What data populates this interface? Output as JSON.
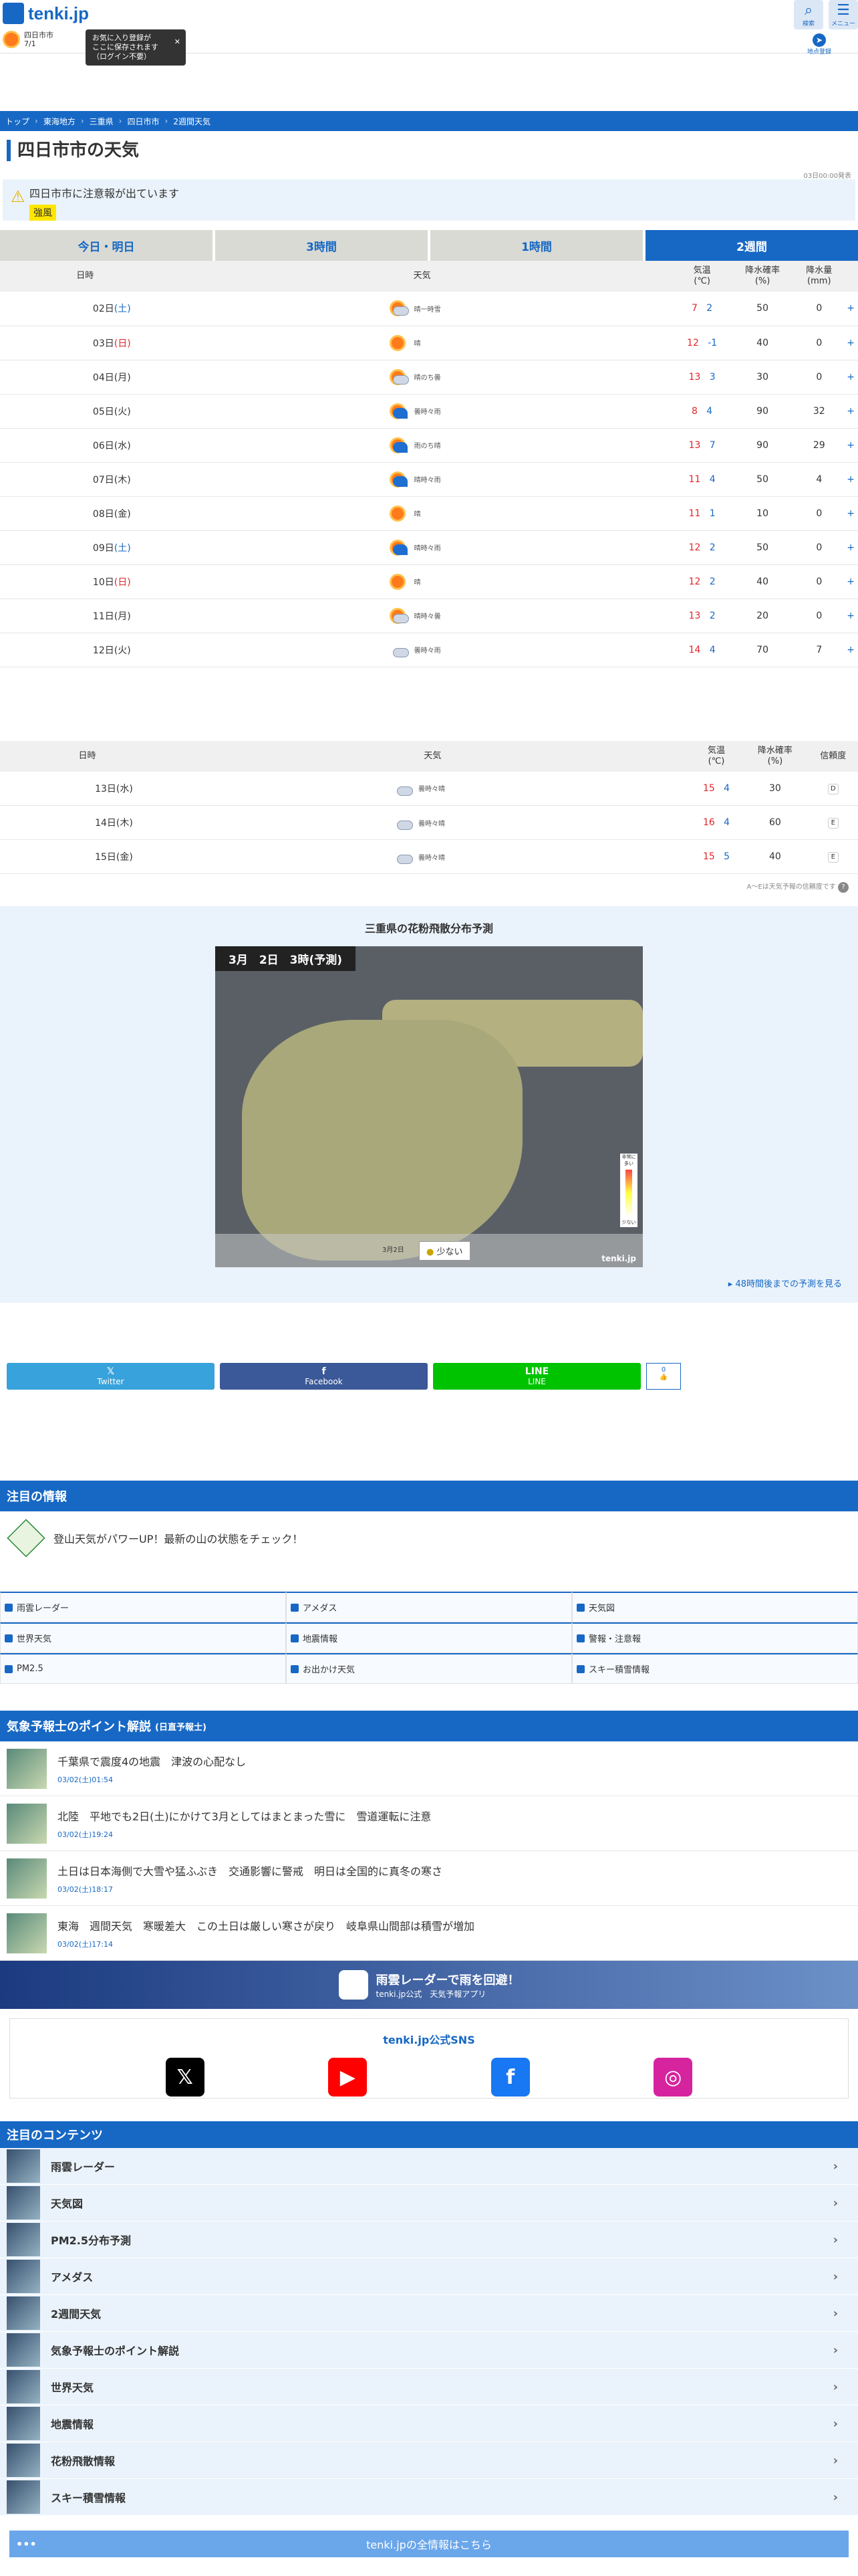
{
  "header": {
    "logo": "tenki.jp",
    "location_name": "四日市市",
    "location_temp": "7/1",
    "tooltip": "お気に入り登録が\nここに保存されます\n（ログイン不要）",
    "search_label": "検索",
    "menu_label": "メニュー",
    "register_label": "地点登録"
  },
  "breadcrumb": [
    "トップ",
    "東海地方",
    "三重県",
    "四日市市",
    "2週間天気"
  ],
  "page_title": "四日市市の天気",
  "updated": "03日00:00発表",
  "warning": {
    "text": "四日市市に注意報が出ています",
    "badge": "強風"
  },
  "tabs": [
    "今日・明日",
    "3時間",
    "1時間",
    "2週間"
  ],
  "table1": {
    "headers": [
      "日時",
      "天気",
      "気温\n(℃)",
      "降水確率\n(%)",
      "降水量\n(mm)",
      ""
    ],
    "rows": [
      {
        "date": "02日",
        "dow": "(土)",
        "cls": "sat",
        "wx": "晴一時雪",
        "icon": "sun-cloud",
        "hi": "7",
        "lo": "2",
        "pop": "50",
        "rain": "0"
      },
      {
        "date": "03日",
        "dow": "(日)",
        "cls": "sun",
        "wx": "晴",
        "icon": "sun",
        "hi": "12",
        "lo": "-1",
        "pop": "40",
        "rain": "0"
      },
      {
        "date": "04日",
        "dow": "(月)",
        "cls": "",
        "wx": "晴のち曇",
        "icon": "sun-cloud",
        "hi": "13",
        "lo": "3",
        "pop": "30",
        "rain": "0"
      },
      {
        "date": "05日",
        "dow": "(火)",
        "cls": "",
        "wx": "曇時々雨",
        "icon": "rain",
        "hi": "8",
        "lo": "4",
        "pop": "90",
        "rain": "32"
      },
      {
        "date": "06日",
        "dow": "(水)",
        "cls": "",
        "wx": "雨のち晴",
        "icon": "rain",
        "hi": "13",
        "lo": "7",
        "pop": "90",
        "rain": "29"
      },
      {
        "date": "07日",
        "dow": "(木)",
        "cls": "",
        "wx": "晴時々雨",
        "icon": "rain",
        "hi": "11",
        "lo": "4",
        "pop": "50",
        "rain": "4"
      },
      {
        "date": "08日",
        "dow": "(金)",
        "cls": "",
        "wx": "晴",
        "icon": "sun",
        "hi": "11",
        "lo": "1",
        "pop": "10",
        "rain": "0"
      },
      {
        "date": "09日",
        "dow": "(土)",
        "cls": "sat",
        "wx": "晴時々雨",
        "icon": "rain",
        "hi": "12",
        "lo": "2",
        "pop": "50",
        "rain": "0"
      },
      {
        "date": "10日",
        "dow": "(日)",
        "cls": "sun",
        "wx": "晴",
        "icon": "sun",
        "hi": "12",
        "lo": "2",
        "pop": "40",
        "rain": "0"
      },
      {
        "date": "11日",
        "dow": "(月)",
        "cls": "",
        "wx": "晴時々曇",
        "icon": "sun-cloud",
        "hi": "13",
        "lo": "2",
        "pop": "20",
        "rain": "0"
      },
      {
        "date": "12日",
        "dow": "(火)",
        "cls": "",
        "wx": "曇時々雨",
        "icon": "cloud",
        "hi": "14",
        "lo": "4",
        "pop": "70",
        "rain": "7"
      }
    ]
  },
  "table2": {
    "headers": [
      "日時",
      "天気",
      "気温\n(℃)",
      "降水確率\n(%)",
      "信頼度"
    ],
    "rows": [
      {
        "date": "13日",
        "dow": "(水)",
        "cls": "",
        "wx": "曇時々晴",
        "icon": "cloud",
        "hi": "15",
        "lo": "4",
        "pop": "30",
        "rel": "D"
      },
      {
        "date": "14日",
        "dow": "(木)",
        "cls": "",
        "wx": "曇時々晴",
        "icon": "cloud",
        "hi": "16",
        "lo": "4",
        "pop": "60",
        "rel": "E"
      },
      {
        "date": "15日",
        "dow": "(金)",
        "cls": "",
        "wx": "曇時々晴",
        "icon": "cloud",
        "hi": "15",
        "lo": "5",
        "pop": "40",
        "rel": "E"
      }
    ],
    "note": "A〜Eは天気予報の信頼度です"
  },
  "pollen": {
    "title": "三重県の花粉飛散分布予測",
    "map_header": "3月　2日　3時(予測)",
    "date_label": "3月2日",
    "level": "少ない",
    "legend_hi": "非常に多い",
    "legend_lo": "少ない",
    "watermark": "tenki.jp",
    "more": "48時間後までの予測を見る"
  },
  "share": [
    {
      "label": "Twitter",
      "glyph": "𝕏",
      "color": "#37a2db"
    },
    {
      "label": "Facebook",
      "glyph": "f",
      "color": "#3b5998"
    },
    {
      "label": "LINE",
      "glyph": "LINE",
      "color": "#00c300"
    }
  ],
  "like_count": "0",
  "attention": {
    "title": "注目の情報",
    "text": "登山天気がパワーUP！最新の山の状態をチェック！"
  },
  "links": [
    "雨雲レーダー",
    "アメダス",
    "天気図",
    "世界天気",
    "地震情報",
    "警報・注意報",
    "PM2.5",
    "お出かけ天気",
    "スキー積雪情報"
  ],
  "points": {
    "title": "気象予報士のポイント解説",
    "sub": "(日直予報士)",
    "items": [
      {
        "title": "千葉県で震度4の地震　津波の心配なし",
        "date": "03/02(土)01:54"
      },
      {
        "title": "北陸　平地でも2日(土)にかけて3月としてはまとまった雪に　雪道運転に注意",
        "date": "03/02(土)19:24"
      },
      {
        "title": "土日は日本海側で大雪や猛ふぶき　交通影響に警戒　明日は全国的に真冬の寒さ",
        "date": "03/02(土)18:17"
      },
      {
        "title": "東海　週間天気　寒暖差大　この土日は厳しい寒さが戻り　岐阜県山間部は積雪が増加",
        "date": "03/02(土)17:14"
      }
    ]
  },
  "banner": {
    "title": "雨雲レーダーで雨を回避！",
    "sub": "tenki.jp公式　天気予報アプリ"
  },
  "sns": {
    "title": "tenki.jp公式SNS",
    "items": [
      {
        "name": "x-icon",
        "glyph": "𝕏",
        "color": "#000"
      },
      {
        "name": "youtube-icon",
        "glyph": "▶",
        "color": "#f00"
      },
      {
        "name": "facebook-icon",
        "glyph": "f",
        "color": "#1877f2"
      },
      {
        "name": "instagram-icon",
        "glyph": "◎",
        "color": "#d6249f"
      }
    ]
  },
  "contents": {
    "title": "注目のコンテンツ",
    "items": [
      "雨雲レーダー",
      "天気図",
      "PM2.5分布予測",
      "アメダス",
      "2週間天気",
      "気象予報士のポイント解説",
      "世界天気",
      "地震情報",
      "花粉飛散情報",
      "スキー積雪情報"
    ]
  },
  "footer": "tenki.jpの全情報はこちら"
}
